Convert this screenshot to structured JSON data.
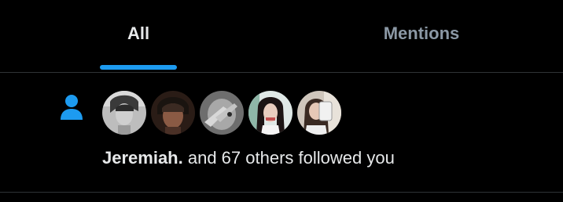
{
  "tabs": [
    {
      "label": "All",
      "selected": true
    },
    {
      "label": "Mentions",
      "selected": false
    }
  ],
  "notification": {
    "type_icon": "person-icon",
    "user_name": "Jeremiah.",
    "rest_text": " and 67 others followed you",
    "avatars": [
      "avatar-1",
      "avatar-2",
      "avatar-3",
      "avatar-4",
      "avatar-5"
    ]
  },
  "colors": {
    "background": "#000000",
    "accent": "#1d9bf0",
    "text_primary": "#e7e9ea",
    "text_secondary": "#8b98a5",
    "divider": "#2f3336"
  }
}
